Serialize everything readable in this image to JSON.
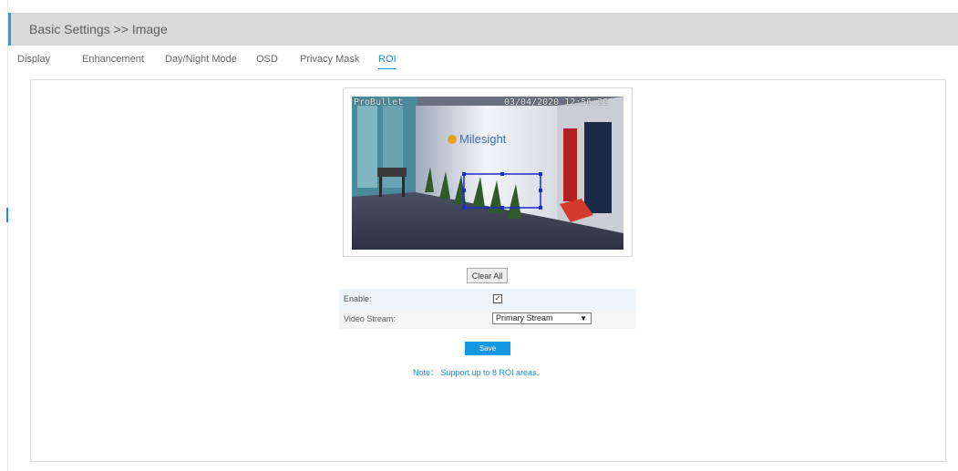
{
  "header": {
    "title": "Basic Settings >> Image"
  },
  "tabs": [
    {
      "label": "Display"
    },
    {
      "label": "Enhancement"
    },
    {
      "label": "Day/Night Mode"
    },
    {
      "label": "OSD"
    },
    {
      "label": "Privacy Mask"
    },
    {
      "label": "ROI",
      "active": true
    }
  ],
  "video": {
    "osd_left": "ProBullet",
    "osd_right": "03/04/2020 12:56:22",
    "logo_text": "Milesight"
  },
  "controls": {
    "clear_all": "Clear All",
    "enable_label": "Enable:",
    "enable_checked": true,
    "stream_label": "Video Stream:",
    "stream_value": "Primary Stream",
    "save": "Save",
    "note": "Note： Support up to 8 ROI areas."
  },
  "colors": {
    "accent": "#1e8fd6",
    "roi_box": "#1a2bd0",
    "header_bg": "#d9d9d9"
  }
}
